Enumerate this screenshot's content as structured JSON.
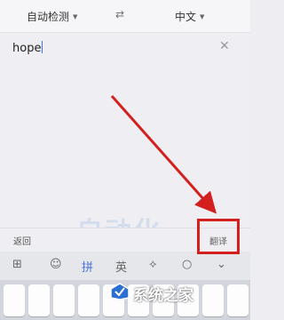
{
  "lang_bar": {
    "source": "自动检测",
    "swap_icon": "⇄",
    "target": "中文"
  },
  "input": {
    "value": "hope",
    "clear_icon": "✕"
  },
  "bottom_bar": {
    "back": "返回",
    "translate": "翻译"
  },
  "watermark": "自动化",
  "keyboard": {
    "toolbar": [
      {
        "name": "grid-icon",
        "glyph": "⊞"
      },
      {
        "name": "emoji-icon",
        "glyph": "☺"
      },
      {
        "name": "pinyin-mode",
        "glyph": "拼"
      },
      {
        "name": "english-mode",
        "glyph": "英"
      },
      {
        "name": "cursor-move-icon",
        "glyph": "⟡"
      },
      {
        "name": "search-icon",
        "glyph": "○"
      },
      {
        "name": "collapse-icon",
        "glyph": "⌄"
      }
    ]
  },
  "brand_watermark": "系统之家",
  "colors": {
    "annotation_red": "#d41f1f",
    "accent_blue": "#4a6fd4"
  }
}
